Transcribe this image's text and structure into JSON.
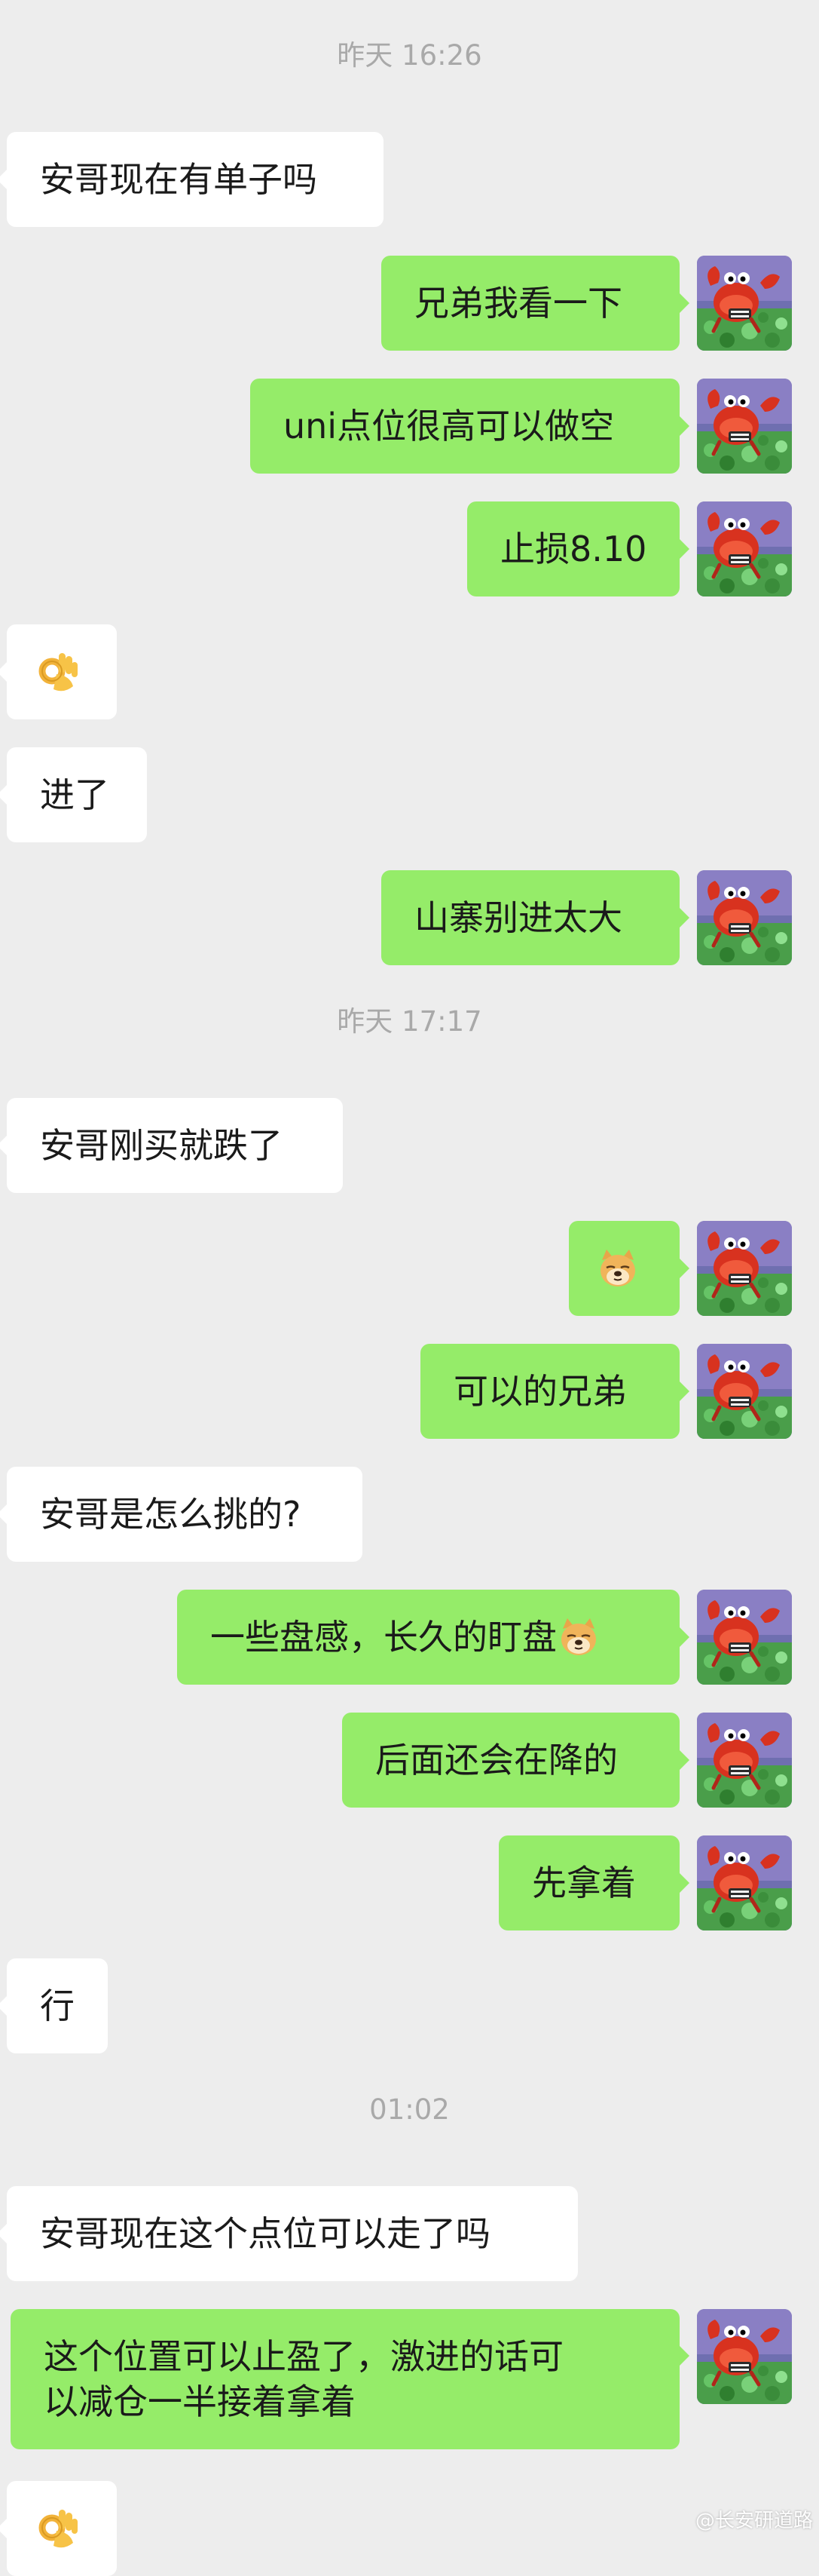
{
  "timestamps": [
    "昨天 16:26",
    "昨天 17:17",
    "01:02"
  ],
  "messages": {
    "m1": "安哥现在有单子吗",
    "m2": "兄弟我看一下",
    "m3": "uni点位很高可以做空",
    "m4": "止损8.10",
    "m6": "进了",
    "m7": "山寨别进太大",
    "m8": "安哥刚买就跌了",
    "m10": "可以的兄弟",
    "m11": "安哥是怎么挑的?",
    "m12": "一些盘感，长久的盯盘",
    "m13": "后面还会在降的",
    "m14": "先拿着",
    "m15": "行",
    "m16": "安哥现在这个点位可以走了吗",
    "m17_line1": "这个位置可以止盈了，激进的话可",
    "m17_line2": "以减仓一半接着拿着"
  },
  "icons": {
    "ok_hand": "ok-hand-emoji",
    "doge": "doge-emoji",
    "avatar": "crab-cartoon-avatar"
  },
  "colors": {
    "background": "#ededed",
    "bubble_self": "#95ec69",
    "bubble_other": "#ffffff",
    "timestamp": "#a9a9a9"
  },
  "watermark": "@长安研道路"
}
